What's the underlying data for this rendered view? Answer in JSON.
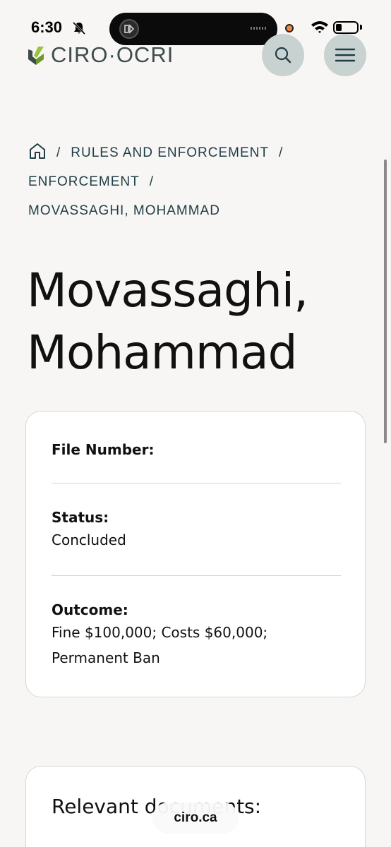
{
  "status_bar": {
    "time": "6:30"
  },
  "header": {
    "logo_text": "CIRO·OCRI"
  },
  "breadcrumb": {
    "items": [
      "RULES AND ENFORCEMENT",
      "ENFORCEMENT",
      "MOVASSAGHI, MOHAMMAD"
    ],
    "separator": "/"
  },
  "page": {
    "title_line1": "Movassaghi,",
    "title_line2": "Mohammad"
  },
  "details": {
    "file_number_label": "File Number:",
    "file_number_value": "",
    "status_label": "Status:",
    "status_value": "Concluded",
    "outcome_label": "Outcome:",
    "outcome_line1": "Fine $100,000; Costs $60,000;",
    "outcome_line2": "Permanent Ban"
  },
  "documents": {
    "heading": "Relevant documents:"
  },
  "browser": {
    "url": "ciro.ca"
  },
  "colors": {
    "background": "#f7f6f4",
    "breadcrumb": "#1f3d46",
    "logo_green": "#6a9a2a",
    "button_bg": "#c8d2d0"
  }
}
